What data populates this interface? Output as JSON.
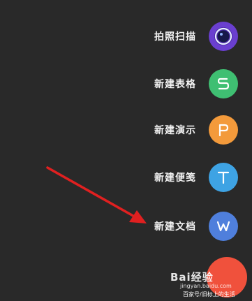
{
  "menu": {
    "scan": {
      "label": "拍照扫描",
      "color": "#6a3fd0",
      "icon": "camera-lens-icon"
    },
    "sheet": {
      "label": "新建表格",
      "color": "#3fbf72",
      "icon": "s-letter-icon",
      "glyph": "S"
    },
    "ppt": {
      "label": "新建演示",
      "color": "#f39a3b",
      "icon": "p-letter-icon",
      "glyph": "P"
    },
    "note": {
      "label": "新建便笺",
      "color": "#3ea3e4",
      "icon": "t-letter-icon",
      "glyph": "T"
    },
    "doc": {
      "label": "新建文档",
      "color": "#4f7fdc",
      "icon": "w-letter-icon",
      "glyph": "W"
    }
  },
  "fab": {
    "color": "#f0513c"
  },
  "annotation": {
    "arrow_color": "#e02020"
  },
  "watermark": {
    "logo": "Bai经验",
    "sub": "jingyan.baidu.com",
    "caption": "百家号/旧标上的生活"
  }
}
